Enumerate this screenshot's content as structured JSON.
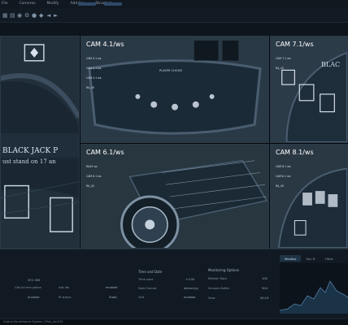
{
  "menubar": {
    "items": [
      "File",
      "Cameras",
      "Modify",
      "Add-Ins",
      "Structure"
    ]
  },
  "cameras": [
    {
      "label": "CAM 4.1/ws",
      "stats": [
        "CAM 4.1 ws",
        "CAM 4 1 ws",
        "CAM 4.1 ws",
        "RA_45"
      ]
    },
    {
      "label": "CAM 7.1/ws",
      "stats": [
        "CAM 7.1 ws",
        "RA_45"
      ]
    },
    {
      "label": "CAM 6.1/ws",
      "stats": [
        "RA45 ws",
        "CAM 6.1 ws",
        "RA_45"
      ]
    },
    {
      "label": "CAM 8.1/ws",
      "stats": [
        "CAM 8.1 ws",
        "CAM 8.1 ws",
        "RA_45"
      ]
    }
  ],
  "table_text": {
    "left_banner": "BLACK JACK P",
    "left_sub": "ust stand on 17 an",
    "right_banner": "BLAC",
    "cam4_banner": "PLAYER CHOICE"
  },
  "panel": {
    "left": {
      "rows": [
        {
          "k": "SEG 868",
          "v": ""
        },
        {
          "k": "Clib Ad encryption",
          "k2": "Ads list",
          "v": "enabled"
        },
        {
          "k": "enabled",
          "k2": "IP status",
          "v": "Static"
        }
      ]
    },
    "time_date": {
      "title": "Time and Date",
      "rows": [
        {
          "k": "Time zone",
          "v": "+1:00"
        },
        {
          "k": "Date Format",
          "v": "dd/mm/yy"
        },
        {
          "k": "24H",
          "v": "enabled"
        }
      ]
    },
    "monitoring": {
      "title": "Monitoring Options",
      "rows": [
        {
          "k": "Refresh Rate",
          "v": "100"
        },
        {
          "k": "Sensors Buffer",
          "v": "504"
        },
        {
          "k": "View",
          "v": "00:19"
        }
      ]
    },
    "tabs": [
      "Monitor",
      "Sun R",
      "Titles"
    ]
  },
  "statusbar": {
    "text": "Casino Surveillance System | Plan_Ad.015"
  }
}
